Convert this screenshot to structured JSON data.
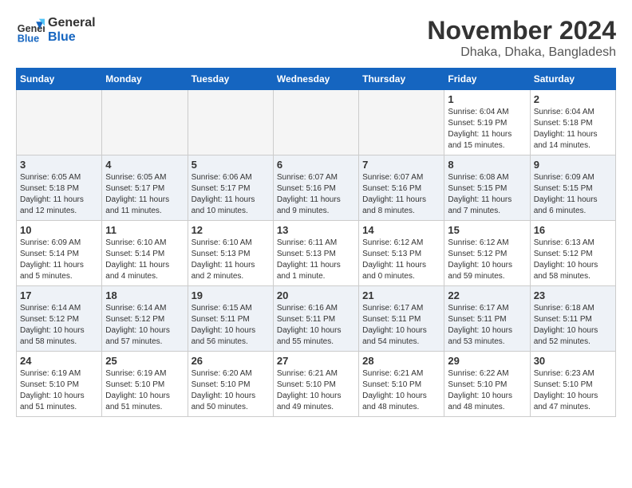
{
  "logo": {
    "line1": "General",
    "line2": "Blue"
  },
  "title": "November 2024",
  "location": "Dhaka, Dhaka, Bangladesh",
  "days_of_week": [
    "Sunday",
    "Monday",
    "Tuesday",
    "Wednesday",
    "Thursday",
    "Friday",
    "Saturday"
  ],
  "weeks": [
    [
      {
        "day": "",
        "info": ""
      },
      {
        "day": "",
        "info": ""
      },
      {
        "day": "",
        "info": ""
      },
      {
        "day": "",
        "info": ""
      },
      {
        "day": "",
        "info": ""
      },
      {
        "day": "1",
        "info": "Sunrise: 6:04 AM\nSunset: 5:19 PM\nDaylight: 11 hours\nand 15 minutes."
      },
      {
        "day": "2",
        "info": "Sunrise: 6:04 AM\nSunset: 5:18 PM\nDaylight: 11 hours\nand 14 minutes."
      }
    ],
    [
      {
        "day": "3",
        "info": "Sunrise: 6:05 AM\nSunset: 5:18 PM\nDaylight: 11 hours\nand 12 minutes."
      },
      {
        "day": "4",
        "info": "Sunrise: 6:05 AM\nSunset: 5:17 PM\nDaylight: 11 hours\nand 11 minutes."
      },
      {
        "day": "5",
        "info": "Sunrise: 6:06 AM\nSunset: 5:17 PM\nDaylight: 11 hours\nand 10 minutes."
      },
      {
        "day": "6",
        "info": "Sunrise: 6:07 AM\nSunset: 5:16 PM\nDaylight: 11 hours\nand 9 minutes."
      },
      {
        "day": "7",
        "info": "Sunrise: 6:07 AM\nSunset: 5:16 PM\nDaylight: 11 hours\nand 8 minutes."
      },
      {
        "day": "8",
        "info": "Sunrise: 6:08 AM\nSunset: 5:15 PM\nDaylight: 11 hours\nand 7 minutes."
      },
      {
        "day": "9",
        "info": "Sunrise: 6:09 AM\nSunset: 5:15 PM\nDaylight: 11 hours\nand 6 minutes."
      }
    ],
    [
      {
        "day": "10",
        "info": "Sunrise: 6:09 AM\nSunset: 5:14 PM\nDaylight: 11 hours\nand 5 minutes."
      },
      {
        "day": "11",
        "info": "Sunrise: 6:10 AM\nSunset: 5:14 PM\nDaylight: 11 hours\nand 4 minutes."
      },
      {
        "day": "12",
        "info": "Sunrise: 6:10 AM\nSunset: 5:13 PM\nDaylight: 11 hours\nand 2 minutes."
      },
      {
        "day": "13",
        "info": "Sunrise: 6:11 AM\nSunset: 5:13 PM\nDaylight: 11 hours\nand 1 minute."
      },
      {
        "day": "14",
        "info": "Sunrise: 6:12 AM\nSunset: 5:13 PM\nDaylight: 11 hours\nand 0 minutes."
      },
      {
        "day": "15",
        "info": "Sunrise: 6:12 AM\nSunset: 5:12 PM\nDaylight: 10 hours\nand 59 minutes."
      },
      {
        "day": "16",
        "info": "Sunrise: 6:13 AM\nSunset: 5:12 PM\nDaylight: 10 hours\nand 58 minutes."
      }
    ],
    [
      {
        "day": "17",
        "info": "Sunrise: 6:14 AM\nSunset: 5:12 PM\nDaylight: 10 hours\nand 58 minutes."
      },
      {
        "day": "18",
        "info": "Sunrise: 6:14 AM\nSunset: 5:12 PM\nDaylight: 10 hours\nand 57 minutes."
      },
      {
        "day": "19",
        "info": "Sunrise: 6:15 AM\nSunset: 5:11 PM\nDaylight: 10 hours\nand 56 minutes."
      },
      {
        "day": "20",
        "info": "Sunrise: 6:16 AM\nSunset: 5:11 PM\nDaylight: 10 hours\nand 55 minutes."
      },
      {
        "day": "21",
        "info": "Sunrise: 6:17 AM\nSunset: 5:11 PM\nDaylight: 10 hours\nand 54 minutes."
      },
      {
        "day": "22",
        "info": "Sunrise: 6:17 AM\nSunset: 5:11 PM\nDaylight: 10 hours\nand 53 minutes."
      },
      {
        "day": "23",
        "info": "Sunrise: 6:18 AM\nSunset: 5:11 PM\nDaylight: 10 hours\nand 52 minutes."
      }
    ],
    [
      {
        "day": "24",
        "info": "Sunrise: 6:19 AM\nSunset: 5:10 PM\nDaylight: 10 hours\nand 51 minutes."
      },
      {
        "day": "25",
        "info": "Sunrise: 6:19 AM\nSunset: 5:10 PM\nDaylight: 10 hours\nand 51 minutes."
      },
      {
        "day": "26",
        "info": "Sunrise: 6:20 AM\nSunset: 5:10 PM\nDaylight: 10 hours\nand 50 minutes."
      },
      {
        "day": "27",
        "info": "Sunrise: 6:21 AM\nSunset: 5:10 PM\nDaylight: 10 hours\nand 49 minutes."
      },
      {
        "day": "28",
        "info": "Sunrise: 6:21 AM\nSunset: 5:10 PM\nDaylight: 10 hours\nand 48 minutes."
      },
      {
        "day": "29",
        "info": "Sunrise: 6:22 AM\nSunset: 5:10 PM\nDaylight: 10 hours\nand 48 minutes."
      },
      {
        "day": "30",
        "info": "Sunrise: 6:23 AM\nSunset: 5:10 PM\nDaylight: 10 hours\nand 47 minutes."
      }
    ]
  ]
}
